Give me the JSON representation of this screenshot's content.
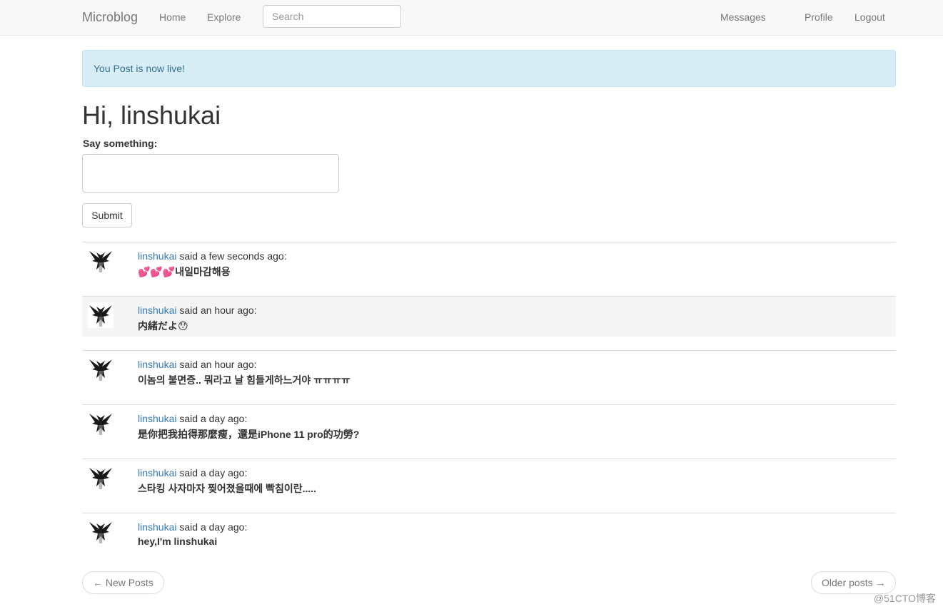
{
  "navbar": {
    "brand": "Microblog",
    "home": "Home",
    "explore": "Explore",
    "search_placeholder": "Search",
    "messages": "Messages",
    "profile": "Profile",
    "logout": "Logout"
  },
  "alert": {
    "text": "You Post is now live!"
  },
  "main": {
    "greeting": "Hi, linshukai",
    "form_label": "Say something:",
    "submit_label": "Submit"
  },
  "posts": [
    {
      "author": "linshukai",
      "said": "said a few seconds ago:",
      "body": "💕💕💕내일마감해용",
      "highlight": false
    },
    {
      "author": "linshukai",
      "said": "said an hour ago:",
      "body": "内緒だよ😯",
      "highlight": true
    },
    {
      "author": "linshukai",
      "said": "said an hour ago:",
      "body": "이놈의 불면증.. 뭐라고 날 힘들게하느거야 ㅠㅠㅠㅠ",
      "highlight": false
    },
    {
      "author": "linshukai",
      "said": "said a day ago:",
      "body": "是你把我拍得那麼瘦，還是iPhone 11 pro的功勞?",
      "highlight": false
    },
    {
      "author": "linshukai",
      "said": "said a day ago:",
      "body": "스타킹 사자마자 찢어졌을때에 빡침이란.....",
      "highlight": false
    },
    {
      "author": "linshukai",
      "said": "said a day ago:",
      "body": "hey,I'm linshukai",
      "highlight": false
    }
  ],
  "pager": {
    "newer": "← New Posts",
    "older": "Older posts →"
  },
  "watermark": "@51CTO博客",
  "colors": {
    "link": "#337ab7",
    "alert_bg": "#d9edf7",
    "alert_text": "#31708f",
    "navbar_bg": "#f8f8f8"
  }
}
